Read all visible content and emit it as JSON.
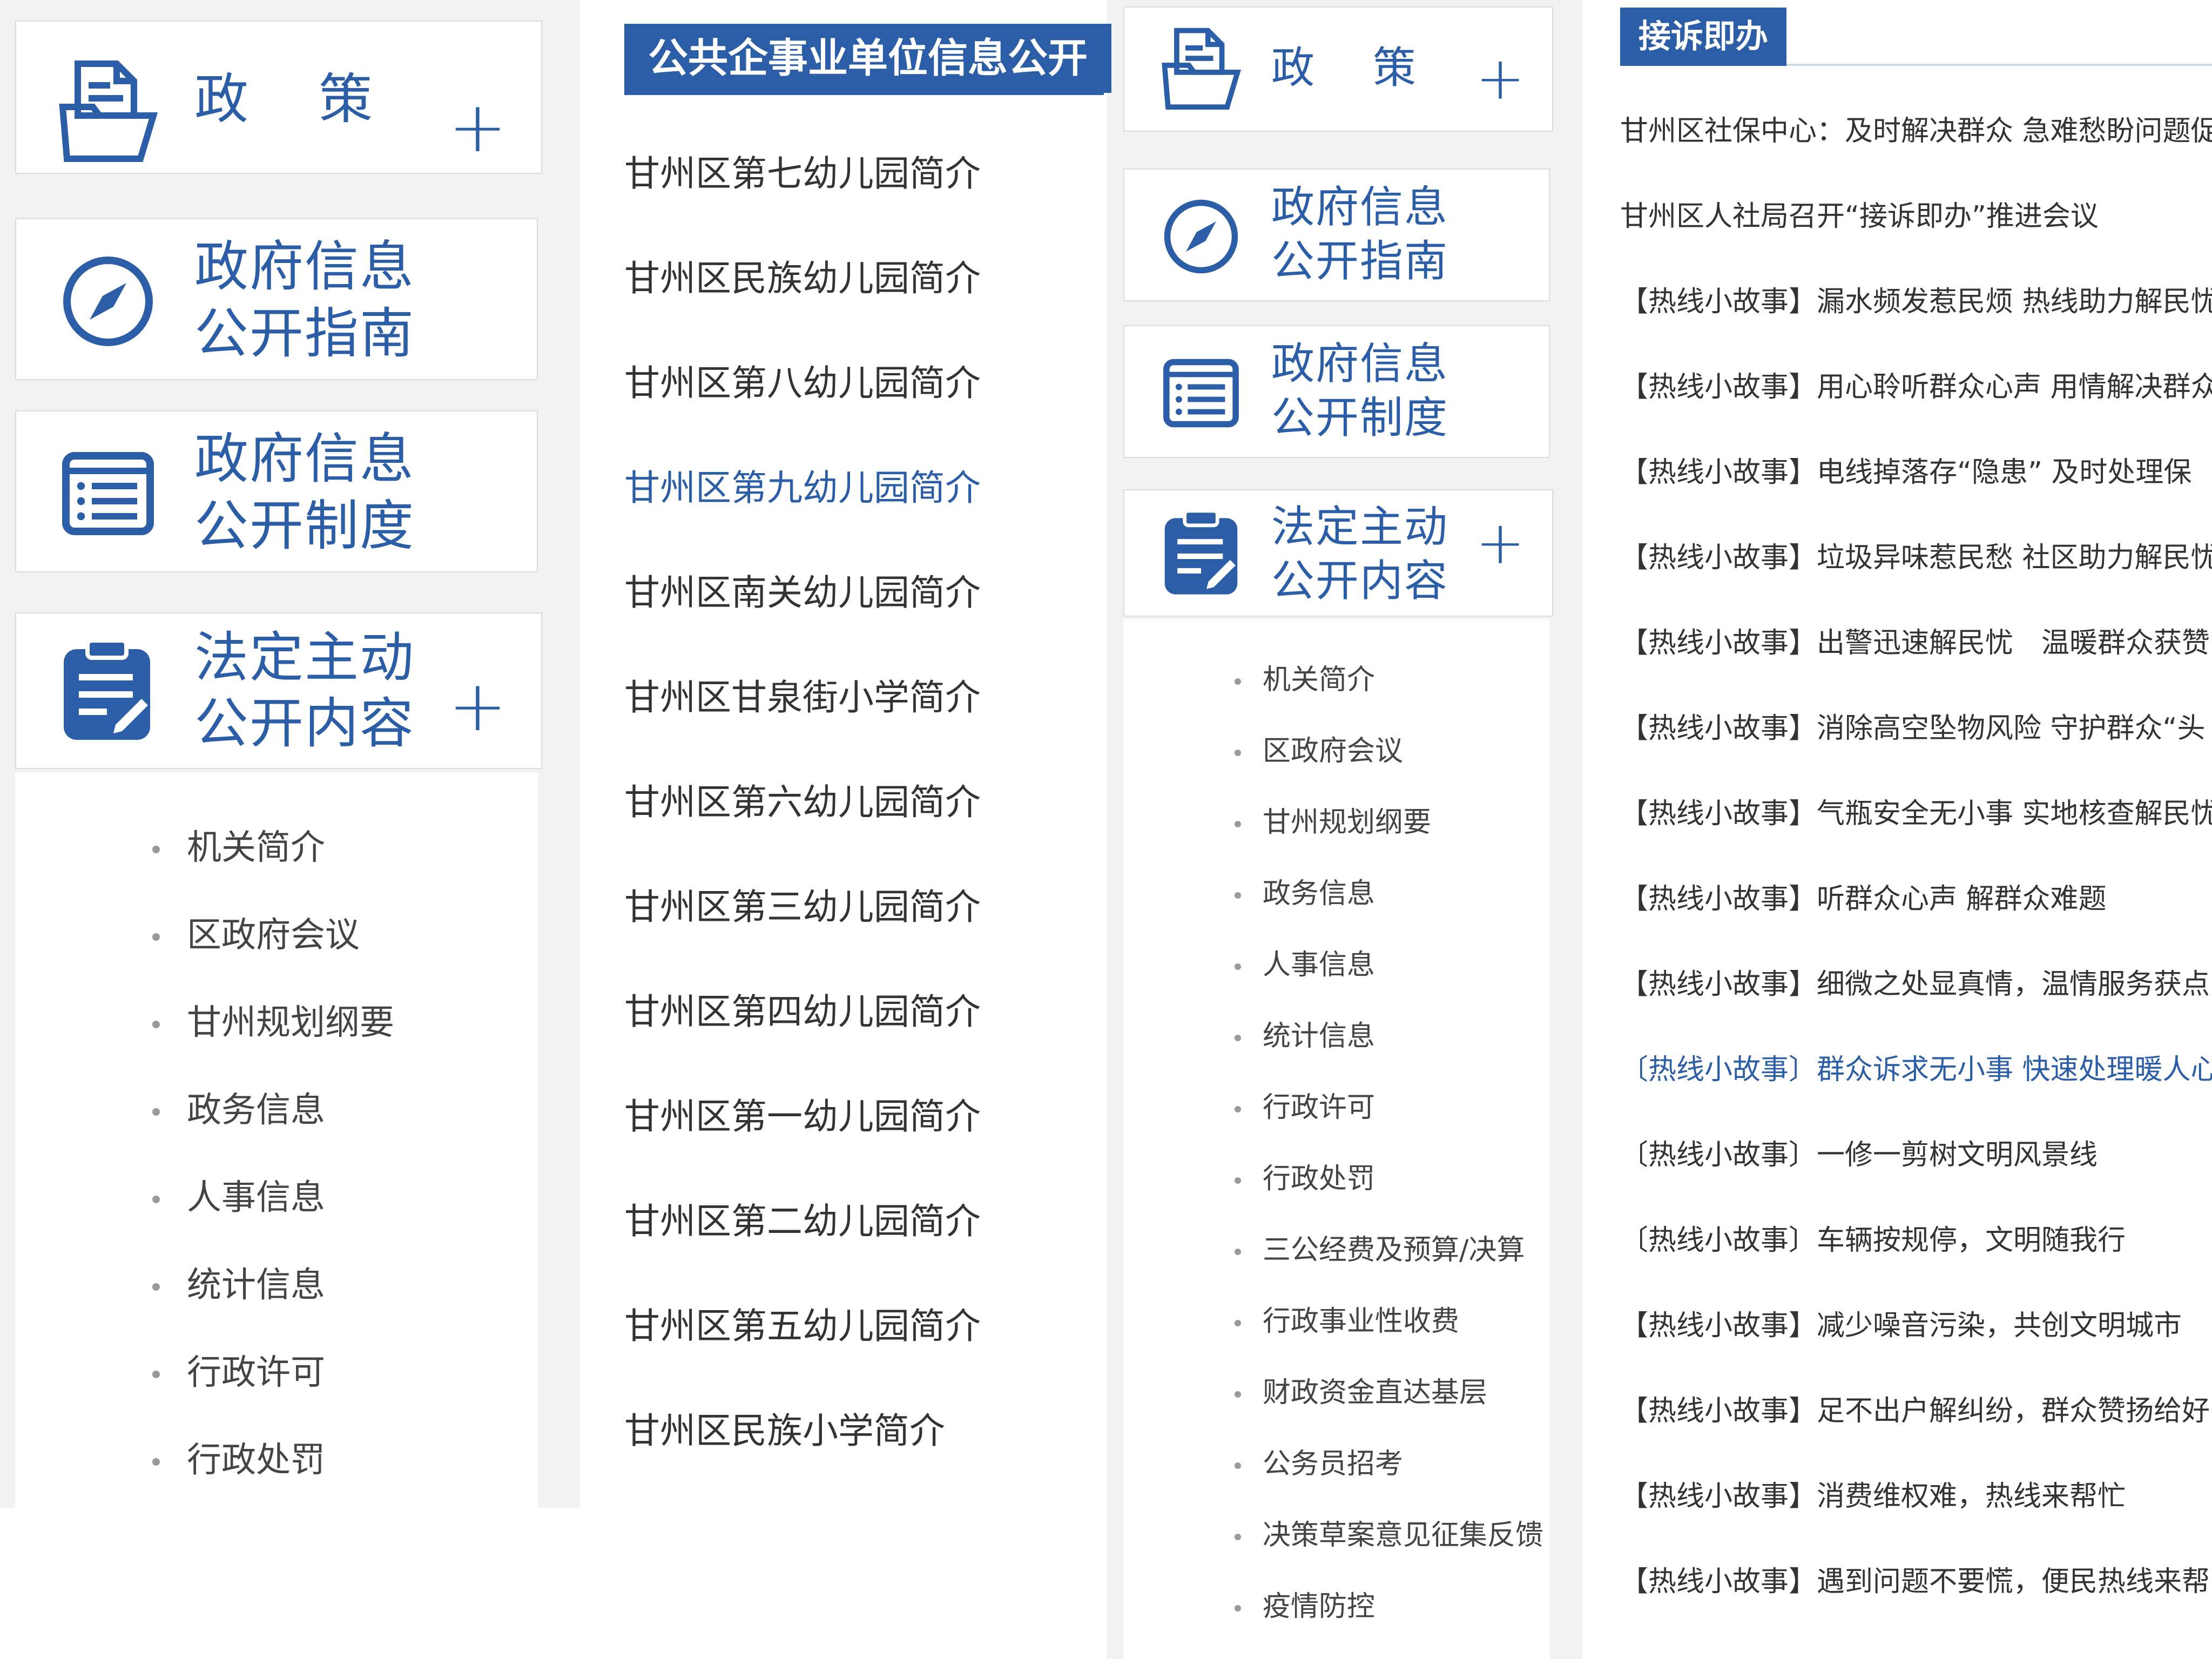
{
  "nav": {
    "policy": {
      "title_a": "政",
      "title_b": "策"
    },
    "guide": {
      "line1": "政府信息",
      "line2": "公开指南"
    },
    "system": {
      "line1": "政府信息",
      "line2": "公开制度"
    },
    "statutory": {
      "line1": "法定主动",
      "line2": "公开内容"
    },
    "plus": "+"
  },
  "statutory_items_left": [
    "机关简介",
    "区政府会议",
    "甘州规划纲要",
    "政务信息",
    "人事信息",
    "统计信息",
    "行政许可",
    "行政处罚"
  ],
  "statutory_items_right": [
    "机关简介",
    "区政府会议",
    "甘州规划纲要",
    "政务信息",
    "人事信息",
    "统计信息",
    "行政许可",
    "行政处罚",
    "三公经费及预算/决算",
    "行政事业性收费",
    "财政资金直达基层",
    "公务员招考",
    "决策草案意见征集反馈",
    "疫情防控"
  ],
  "public_institutions": {
    "header": "公共企事业单位信息公开",
    "items": [
      "甘州区第七幼儿园简介",
      "甘州区民族幼儿园简介",
      "甘州区第八幼儿园简介",
      "甘州区第九幼儿园简介",
      "甘州区南关幼儿园简介",
      "甘州区甘泉街小学简介",
      "甘州区第六幼儿园简介",
      "甘州区第三幼儿园简介",
      "甘州区第四幼儿园简介",
      "甘州区第一幼儿园简介",
      "甘州区第二幼儿园简介",
      "甘州区第五幼儿园简介",
      "甘州区民族小学简介"
    ],
    "active_index": 3
  },
  "hotline": {
    "header": "接诉即办",
    "items": [
      "甘州区社保中心：及时解决群众 急难愁盼问题促",
      "甘州区人社局召开“接诉即办”推进会议",
      "【热线小故事】漏水频发惹民烦 热线助力解民忧",
      "【热线小故事】用心聆听群众心声 用情解决群众",
      "【热线小故事】电线掉落存“隐患” 及时处理保",
      "【热线小故事】垃圾异味惹民愁 社区助力解民忧",
      "【热线小故事】出警迅速解民忧　温暖群众获赞",
      "【热线小故事】消除高空坠物风险 守护群众“头",
      "【热线小故事】气瓶安全无小事 实地核查解民忧",
      "【热线小故事】听群众心声 解群众难题",
      "【热线小故事】细微之处显真情，温情服务获点",
      "〔热线小故事〕群众诉求无小事 快速处理暖人心",
      "〔热线小故事〕一修一剪树文明风景线",
      "〔热线小故事〕车辆按规停，文明随我行",
      "【热线小故事】减少噪音污染，共创文明城市",
      "【热线小故事】足不出户解纠纷，群众赞扬给好",
      "【热线小故事】消费维权难，热线来帮忙",
      "【热线小故事】遇到问题不要慌，便民热线来帮"
    ],
    "active_index": 11
  },
  "colors": {
    "accent": "#2b5ea6",
    "border": "#dcdcdc",
    "background": "#f2f2f2"
  }
}
